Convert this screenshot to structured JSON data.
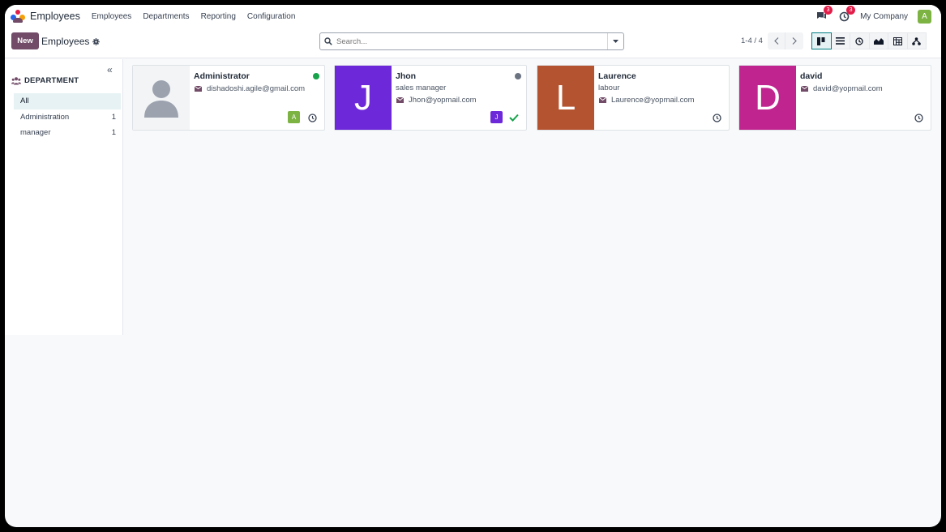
{
  "navbar": {
    "app_name": "Employees",
    "menu": [
      "Employees",
      "Departments",
      "Reporting",
      "Configuration"
    ],
    "messages_count": "3",
    "activities_count": "3",
    "company": "My Company",
    "user_initial": "A"
  },
  "control": {
    "new_label": "New",
    "title": "Employees",
    "search_placeholder": "Search...",
    "pager": "1-4 / 4"
  },
  "sidebar": {
    "heading": "DEPARTMENT",
    "items": [
      {
        "label": "All",
        "count": ""
      },
      {
        "label": "Administration",
        "count": "1"
      },
      {
        "label": "manager",
        "count": "1"
      }
    ]
  },
  "employees": [
    {
      "name": "Administrator",
      "job": "",
      "email": "dishadoshi.agile@gmail.com",
      "initial": "",
      "photo_color": "#f3f4f6",
      "status_color": "#16a34a",
      "user_initial": "A",
      "user_color": "#7cb342"
    },
    {
      "name": "Jhon",
      "job": "sales manager",
      "email": "Jhon@yopmail.com",
      "initial": "J",
      "photo_color": "#6d28d9",
      "status_color": "#6b7280",
      "user_initial": "J",
      "user_color": "#6d28d9"
    },
    {
      "name": "Laurence",
      "job": "labour",
      "email": "Laurence@yopmail.com",
      "initial": "L",
      "photo_color": "#b45330",
      "status_color": "",
      "user_initial": "",
      "user_color": ""
    },
    {
      "name": "david",
      "job": "",
      "email": "david@yopmail.com",
      "initial": "D",
      "photo_color": "#c0258f",
      "status_color": "",
      "user_initial": "",
      "user_color": ""
    }
  ]
}
